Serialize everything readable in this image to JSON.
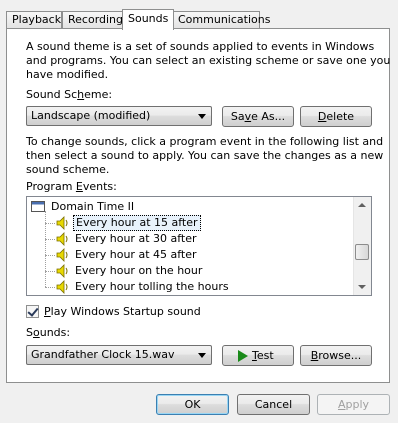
{
  "tabs": [
    {
      "label": "Playback"
    },
    {
      "label": "Recording"
    },
    {
      "label": "Sounds"
    },
    {
      "label": "Communications"
    }
  ],
  "intro": {
    "line1": "A sound theme is a set of sounds applied to events in Windows",
    "line2": "and programs.  You can select an existing scheme or save one you",
    "line3": "have modified."
  },
  "scheme": {
    "label_pre": "Sound Sc",
    "label_key": "h",
    "label_post": "eme:",
    "selected": "Landscape (modified)",
    "save_label_pre": "Sa",
    "save_label_key": "v",
    "save_label_post": "e As...",
    "delete_label_key": "D",
    "delete_label_post": "elete"
  },
  "instructions": {
    "line1": "To change sounds, click a program event in the following list and",
    "line2": "then select a sound to apply.  You can save the changes as a new",
    "line3": "sound scheme."
  },
  "events": {
    "label_pre": "Program ",
    "label_key": "E",
    "label_post": "vents:",
    "group": "Domain Time II",
    "items": [
      {
        "label": "Every hour at 15 after"
      },
      {
        "label": "Every hour at 30 after"
      },
      {
        "label": "Every hour at 45 after"
      },
      {
        "label": "Every hour on the hour"
      },
      {
        "label": "Every hour tolling the hours"
      }
    ]
  },
  "startup": {
    "checked": true,
    "label_key": "P",
    "label_post": "lay Windows Startup sound"
  },
  "sounds": {
    "label_pre": "S",
    "label_key": "o",
    "label_post": "unds:",
    "selected": "Grandfather Clock 15.wav",
    "test_label_key": "T",
    "test_label_post": "est",
    "browse_label_key": "B",
    "browse_label_post": "rowse..."
  },
  "footer": {
    "ok_label": "OK",
    "cancel_label": "Cancel",
    "apply_label_key": "A",
    "apply_label_post": "pply"
  },
  "colors": {
    "selection": "#e8f2fb",
    "speaker": "#e8d800",
    "play_arrow": "#1a8a1a"
  }
}
